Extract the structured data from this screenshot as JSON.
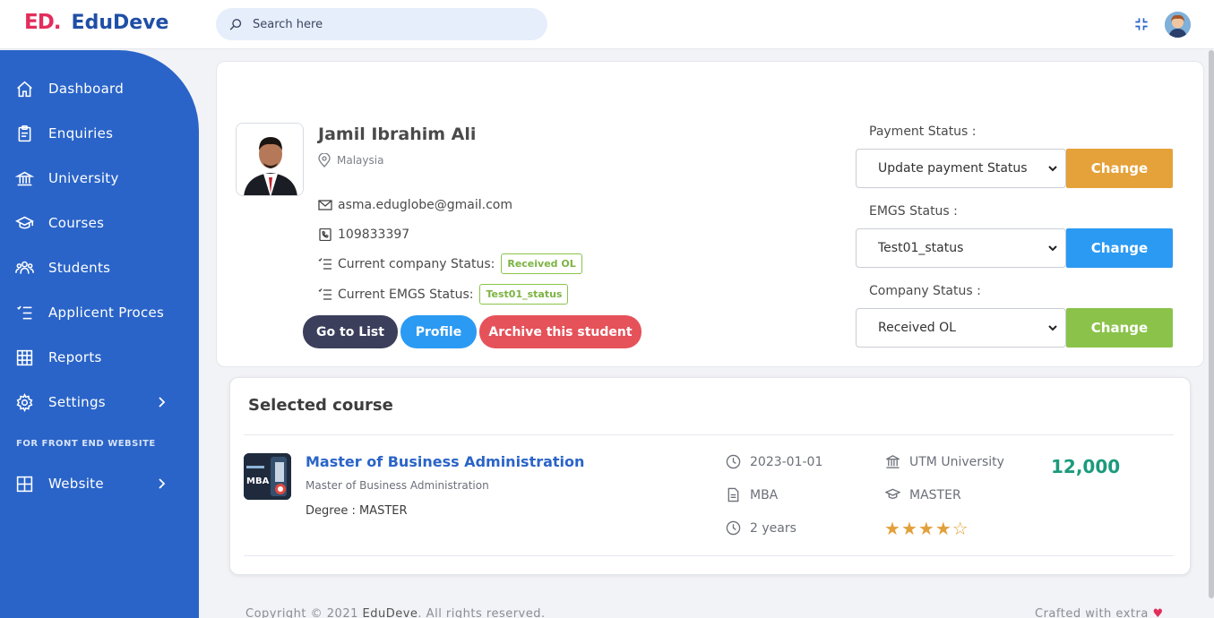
{
  "app": {
    "logo_mark": "ED.",
    "name": "EduDeve"
  },
  "search": {
    "placeholder": "Search here"
  },
  "sidebar": {
    "items": [
      {
        "label": "Dashboard",
        "icon": "home-icon"
      },
      {
        "label": "Enquiries",
        "icon": "clipboard-icon"
      },
      {
        "label": "University",
        "icon": "bank-icon"
      },
      {
        "label": "Courses",
        "icon": "graduation-cap-icon"
      },
      {
        "label": "Students",
        "icon": "users-icon"
      },
      {
        "label": "Applicent Proces",
        "icon": "checklist-icon"
      },
      {
        "label": "Reports",
        "icon": "grid-icon"
      },
      {
        "label": "Settings",
        "icon": "gear-icon"
      }
    ],
    "section_label": "FOR FRONT END WEBSITE",
    "website_label": "Website"
  },
  "student": {
    "name": "Jamil Ibrahim Ali",
    "location": "Malaysia",
    "email": "asma.eduglobe@gmail.com",
    "phone": "109833397",
    "company_status_label": "Current company Status:",
    "company_status_value": "Received OL",
    "emgs_status_label": "Current EMGS Status:",
    "emgs_status_value": "Test01_status"
  },
  "actions": {
    "go_to_list": "Go to List",
    "profile": "Profile",
    "archive": "Archive this student"
  },
  "status_panel": {
    "payment_label": "Payment Status :",
    "payment_value": "Update payment Status",
    "emgs_label": "EMGS Status :",
    "emgs_value": "Test01_status",
    "company_label": "Company Status :",
    "company_value": "Received OL",
    "change_label": "Change"
  },
  "selected_course": {
    "heading": "Selected course",
    "thumb_text": "MBA",
    "name": "Master of Business Administration",
    "subtitle": "Master of Business Administration",
    "degree": "Degree : MASTER",
    "start_date": "2023-01-01",
    "code": "MBA",
    "duration": "2 years",
    "university": "UTM University",
    "level": "MASTER",
    "rating": 4,
    "rating_max": 5,
    "fee": "12,000"
  },
  "footer": {
    "copyright_prefix": "Copyright © 2021",
    "brand": "EduDeve",
    "copyright_suffix": ". All rights reserved.",
    "crafted": "Crafted with extra"
  },
  "colors": {
    "sidebar": "#2a64c8",
    "brand_red": "#e32d5b",
    "change_payment": "#e5a23a",
    "change_emgs": "#2b9af3",
    "change_company": "#8bc34a",
    "go_to_list": "#3b3f5c",
    "profile": "#2b9af3",
    "archive": "#e5525a",
    "price": "#1c9a7d"
  }
}
